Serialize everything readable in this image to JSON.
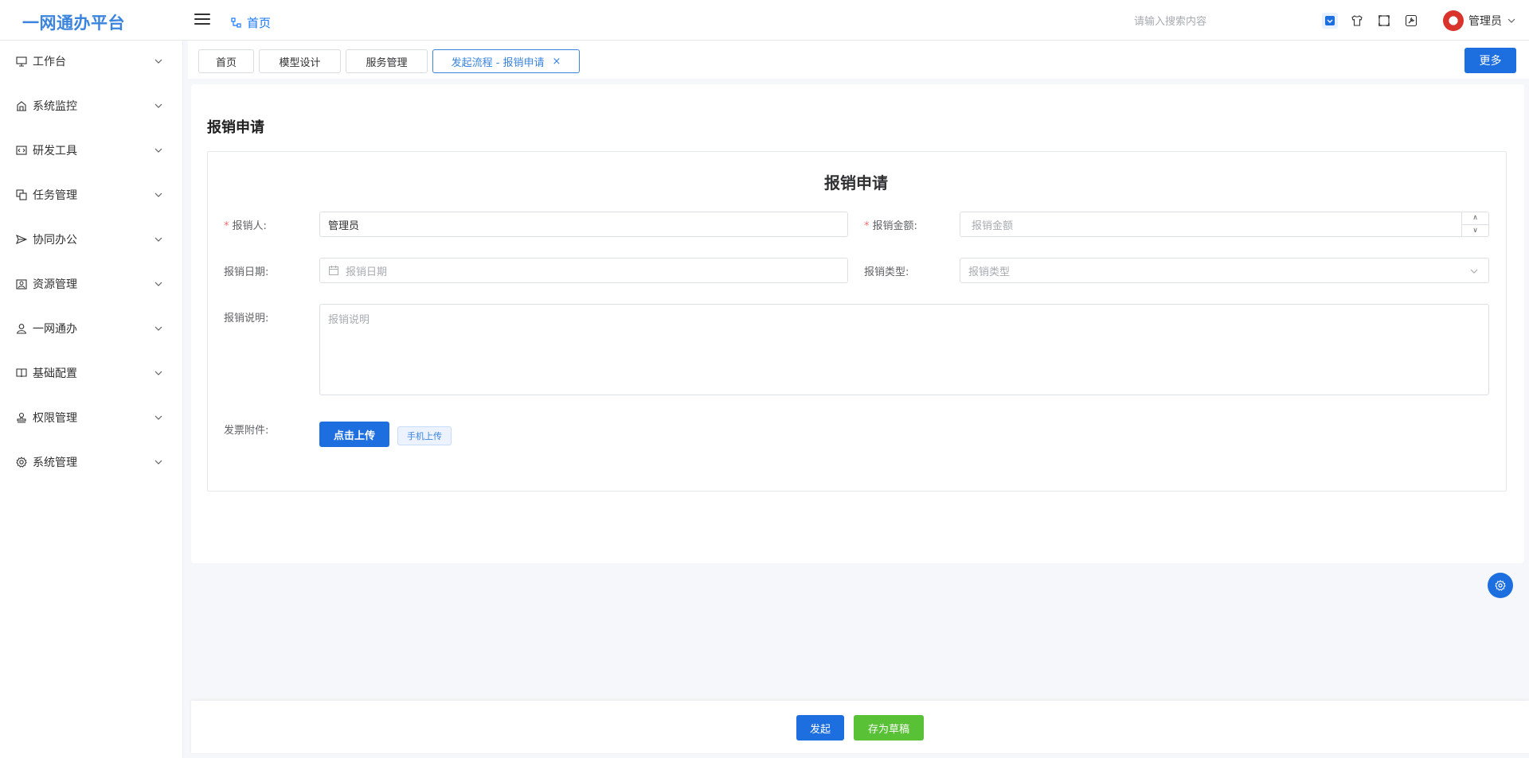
{
  "app": {
    "title": "一网通办平台"
  },
  "header": {
    "breadcrumb": "首页",
    "search_placeholder": "请输入搜索内容",
    "icons": [
      "collapse-icon",
      "shirt-icon",
      "fullscreen-icon",
      "tool-icon"
    ],
    "user_name": "管理员"
  },
  "sidebar": {
    "items": [
      {
        "label": "工作台",
        "icon": "monitor-icon"
      },
      {
        "label": "系统监控",
        "icon": "monitor-tower-icon"
      },
      {
        "label": "研发工具",
        "icon": "code-icon"
      },
      {
        "label": "任务管理",
        "icon": "copy-icon"
      },
      {
        "label": "协同办公",
        "icon": "send-icon"
      },
      {
        "label": "资源管理",
        "icon": "resource-icon"
      },
      {
        "label": "一网通办",
        "icon": "user-icon"
      },
      {
        "label": "基础配置",
        "icon": "book-icon"
      },
      {
        "label": "权限管理",
        "icon": "stamp-icon"
      },
      {
        "label": "系统管理",
        "icon": "gear-icon"
      }
    ]
  },
  "tabs": [
    {
      "label": "首页"
    },
    {
      "label": "模型设计"
    },
    {
      "label": "服务管理"
    },
    {
      "label": "发起流程 - 报销申请",
      "active": true,
      "close": "×"
    }
  ],
  "more_label": "更多",
  "page_title": "报销申请",
  "form": {
    "title": "报销申请",
    "applicant": {
      "label": "报销人:",
      "value": "管理员",
      "required": "*"
    },
    "amount": {
      "label": "报销金额:",
      "placeholder": "报销金额",
      "required": "*"
    },
    "date": {
      "label": "报销日期:",
      "placeholder": "报销日期"
    },
    "type": {
      "label": "报销类型:",
      "placeholder": "报销类型"
    },
    "description": {
      "label": "报销说明:",
      "placeholder": "报销说明"
    },
    "attachment": {
      "label": "发票附件:",
      "upload_label": "点击上传",
      "phone_upload_label": "手机上传"
    }
  },
  "footer": {
    "submit_label": "发起",
    "draft_label": "存为草稿"
  },
  "colors": {
    "primary": "#1d6fe0",
    "success": "#58c136",
    "brand": "#3a84de",
    "required": "#f56c6c"
  }
}
